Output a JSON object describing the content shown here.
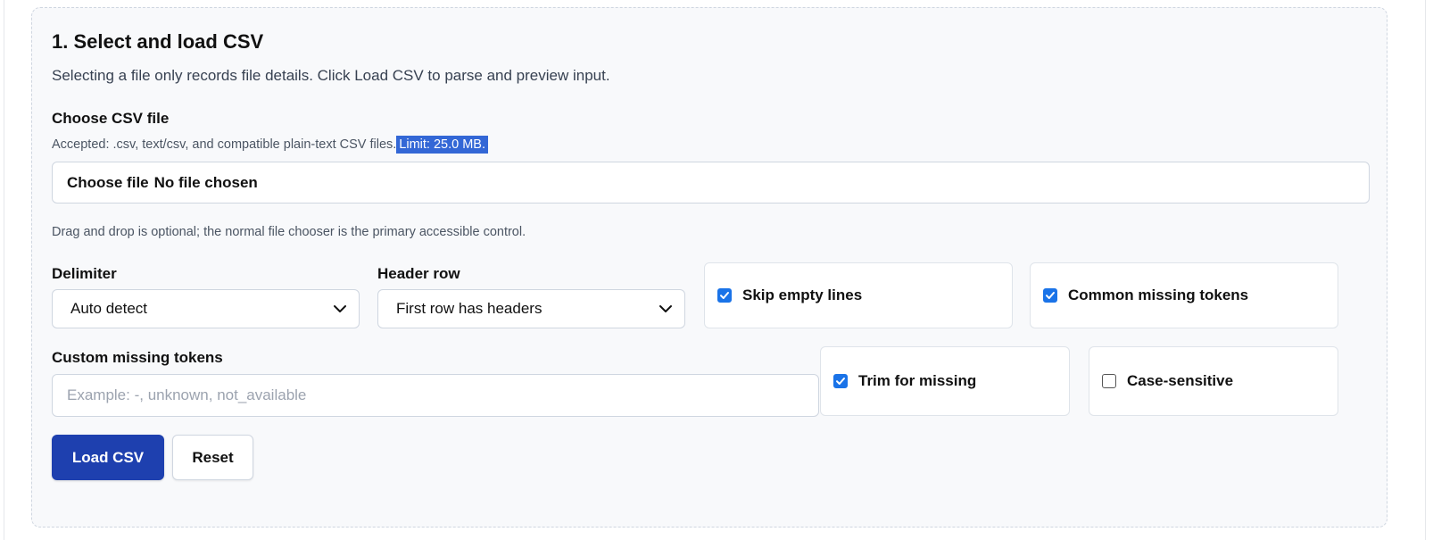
{
  "section": {
    "title": "1. Select and load CSV",
    "description": "Selecting a file only records file details. Click Load CSV to parse and preview input."
  },
  "file": {
    "label": "Choose CSV file",
    "accepted_hint": "Accepted: .csv, text/csv, and compatible plain-text CSV files.",
    "limit_hint": "Limit: 25.0 MB.",
    "button_label": "Choose file",
    "status": "No file chosen",
    "dnd_hint": "Drag and drop is optional; the normal file chooser is the primary accessible control."
  },
  "delimiter": {
    "label": "Delimiter",
    "selected": "Auto detect"
  },
  "header_row": {
    "label": "Header row",
    "selected": "First row has headers"
  },
  "options": {
    "skip_empty": {
      "label": "Skip empty lines",
      "checked": true
    },
    "common_missing": {
      "label": "Common missing tokens",
      "checked": true
    },
    "trim_missing": {
      "label": "Trim for missing",
      "checked": true
    },
    "case_sensitive": {
      "label": "Case-sensitive",
      "checked": false
    }
  },
  "custom_missing": {
    "label": "Custom missing tokens",
    "placeholder": "Example: -, unknown, not_available"
  },
  "actions": {
    "load_label": "Load CSV",
    "reset_label": "Reset"
  },
  "colors": {
    "primary": "#1e40af",
    "checkbox": "#1a73e8",
    "highlight": "#3367d6"
  }
}
